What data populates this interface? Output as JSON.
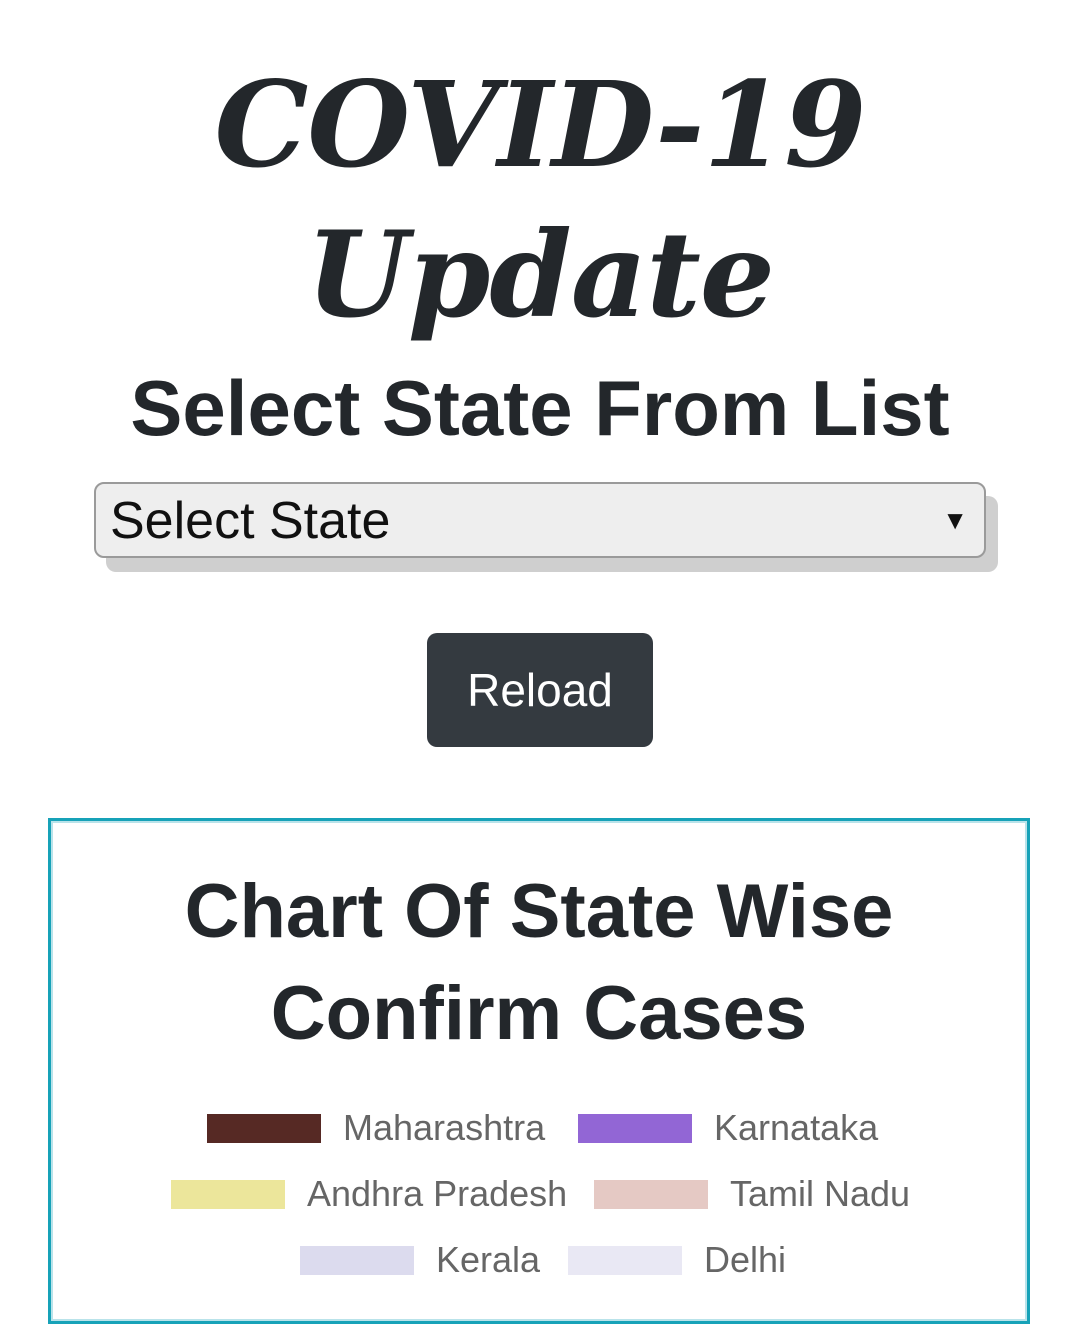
{
  "header": {
    "title": "COVID-19 Update"
  },
  "state_selector": {
    "heading": "Select State From List",
    "selected_value": "Select State",
    "caret_icon": "dropdown-triangle-icon"
  },
  "actions": {
    "reload_label": "Reload",
    "reload_color": "#343a40"
  },
  "chart_card": {
    "title": "Chart Of State Wise Confirm Cases",
    "border_color": "#17a2b8",
    "legend": [
      {
        "label": "Maharashtra",
        "color": "#562924"
      },
      {
        "label": "Karnataka",
        "color": "#9266d5"
      },
      {
        "label": "Andhra Pradesh",
        "color": "#ece69b"
      },
      {
        "label": "Tamil Nadu",
        "color": "#e5c9c4"
      },
      {
        "label": "Kerala",
        "color": "#dcdbee"
      },
      {
        "label": "Delhi",
        "color": "#e9e8f4"
      }
    ]
  },
  "chart_data": {
    "type": "bar",
    "title": "Chart Of State Wise Confirm Cases",
    "legend": [
      "Maharashtra",
      "Karnataka",
      "Andhra Pradesh",
      "Tamil Nadu",
      "Kerala",
      "Delhi"
    ],
    "legend_position": "top",
    "series": []
  }
}
